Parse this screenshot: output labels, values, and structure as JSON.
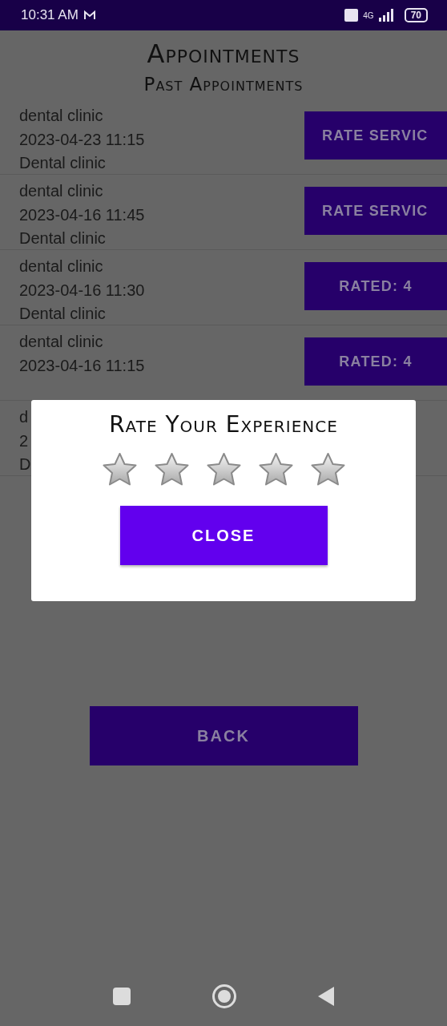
{
  "status_bar": {
    "time": "10:31 AM",
    "battery": "70",
    "network": "4G"
  },
  "title": "Appointments",
  "subtitle": "Past Appointments",
  "appointments": [
    {
      "lines": [
        "dental clinic",
        "2023-04-23 11:15",
        "Dental clinic"
      ],
      "button": "RATE SERVIC"
    },
    {
      "lines": [
        "dental clinic",
        "2023-04-16 11:45",
        "Dental clinic"
      ],
      "button": "RATE SERVIC"
    },
    {
      "lines": [
        "dental clinic",
        "2023-04-16 11:30",
        "Dental clinic"
      ],
      "button": "RATED: 4"
    },
    {
      "lines": [
        "dental clinic",
        "2023-04-16 11:15"
      ],
      "button": "RATED: 4"
    },
    {
      "lines": [
        "d",
        "2",
        "D"
      ]
    }
  ],
  "back_button": "BACK",
  "dialog": {
    "title": "Rate Your Experience",
    "stars": 0,
    "close_button": "CLOSE"
  }
}
